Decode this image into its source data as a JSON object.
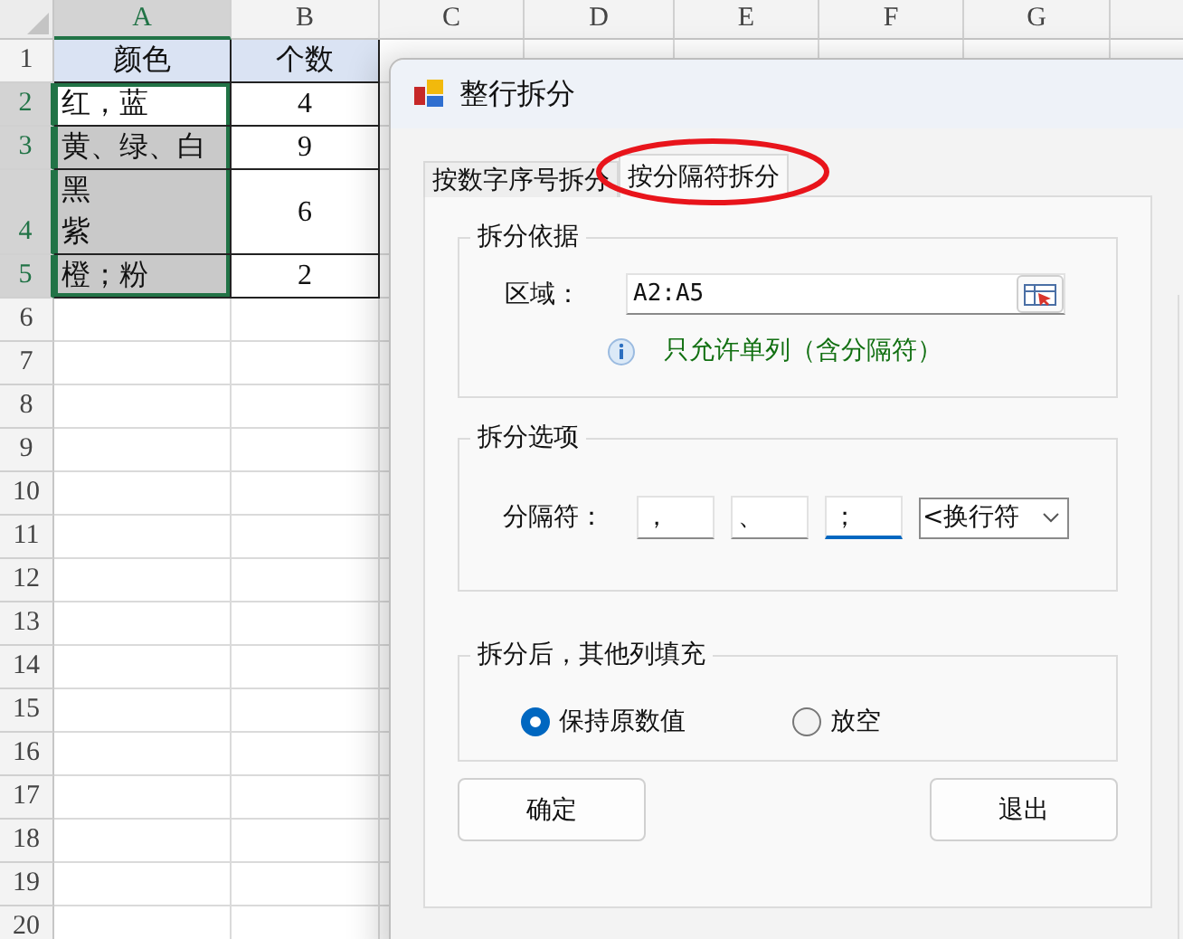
{
  "sheet": {
    "columns": [
      {
        "label": "A",
        "selected": true
      },
      {
        "label": "B",
        "selected": false
      },
      {
        "label": "C",
        "selected": false
      },
      {
        "label": "D",
        "selected": false
      },
      {
        "label": "E",
        "selected": false
      },
      {
        "label": "F",
        "selected": false
      },
      {
        "label": "G",
        "selected": false
      }
    ],
    "rows": [
      {
        "number": "1",
        "selected": false,
        "cells": [
          {
            "text": "颜色",
            "kind": "header",
            "selected": false
          },
          {
            "text": "个数",
            "kind": "header",
            "selected": false
          }
        ]
      },
      {
        "number": "2",
        "selected": true,
        "cells": [
          {
            "text": "红，蓝",
            "kind": "plain",
            "selected": true
          },
          {
            "text": "4",
            "kind": "plain",
            "selected": false
          }
        ]
      },
      {
        "number": "3",
        "selected": true,
        "cells": [
          {
            "text": "黄、绿、白",
            "kind": "shaded",
            "selected": true
          },
          {
            "text": "9",
            "kind": "plain",
            "selected": false
          }
        ]
      },
      {
        "number": "4",
        "selected": true,
        "cells": [
          {
            "lines": [
              "黑",
              "紫"
            ],
            "kind": "shaded",
            "selected": true
          },
          {
            "text": "6",
            "kind": "plain",
            "selected": false
          }
        ]
      },
      {
        "number": "5",
        "selected": true,
        "cells": [
          {
            "text": "橙；粉",
            "kind": "shaded",
            "selected": true
          },
          {
            "text": "2",
            "kind": "plain",
            "selected": false
          }
        ]
      },
      {
        "number": "6",
        "selected": false
      },
      {
        "number": "7",
        "selected": false
      },
      {
        "number": "8",
        "selected": false
      },
      {
        "number": "9",
        "selected": false
      },
      {
        "number": "10",
        "selected": false
      },
      {
        "number": "11",
        "selected": false
      },
      {
        "number": "12",
        "selected": false
      },
      {
        "number": "13",
        "selected": false
      },
      {
        "number": "14",
        "selected": false
      },
      {
        "number": "15",
        "selected": false
      },
      {
        "number": "16",
        "selected": false
      },
      {
        "number": "17",
        "selected": false
      },
      {
        "number": "18",
        "selected": false
      },
      {
        "number": "19",
        "selected": false
      },
      {
        "number": "20",
        "selected": false
      }
    ]
  },
  "dialog": {
    "title": "整行拆分",
    "tabs": [
      {
        "label": "按数字序号拆分",
        "selected": false,
        "circled": false
      },
      {
        "label": "按分隔符拆分",
        "selected": true,
        "circled": true
      }
    ],
    "basis": {
      "title": "拆分依据",
      "range_label": "区域：",
      "range_value": "A2:A5",
      "hint": "只允许单列（含分隔符）"
    },
    "options": {
      "title": "拆分选项",
      "separator_label": "分隔符：",
      "separators": [
        {
          "value": "，",
          "focused": false
        },
        {
          "value": "、",
          "focused": false
        },
        {
          "value": "；",
          "focused": true
        }
      ],
      "dropdown_value": "<换行符"
    },
    "fill": {
      "title": "拆分后，其他列填充",
      "choices": [
        {
          "label": "保持原数值",
          "selected": true
        },
        {
          "label": "放空",
          "selected": false
        }
      ]
    },
    "buttons": [
      "确定",
      "退出"
    ]
  }
}
